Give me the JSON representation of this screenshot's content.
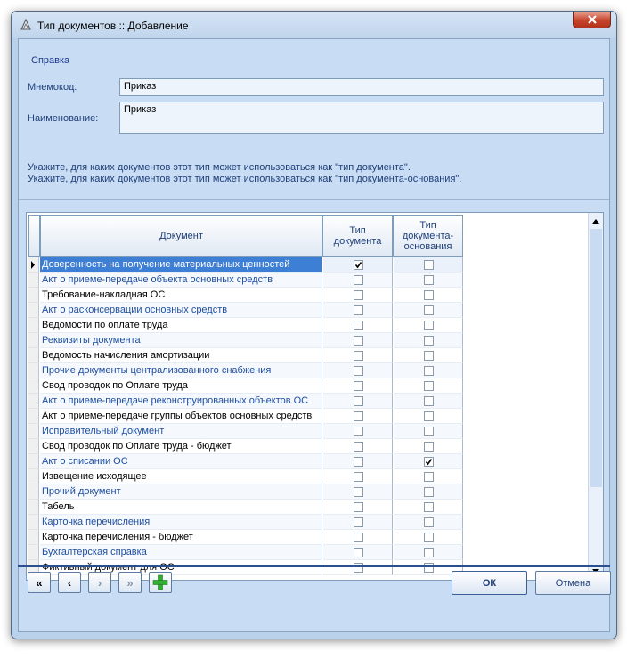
{
  "window": {
    "title": "Тип документов :: Добавление"
  },
  "menu": {
    "help": "Справка"
  },
  "form": {
    "mnemocode_label": "Мнемокод:",
    "mnemocode_value": "Приказ",
    "name_label": "Наименование:",
    "name_value": "Приказ"
  },
  "hints": [
    "Укажите, для каких документов этот тип может использоваться как \"тип документа\".",
    "Укажите, для каких документов этот тип может использоваться как \"тип документа-основания\"."
  ],
  "grid": {
    "columns": {
      "document": "Документ",
      "doc_type": "Тип документа",
      "base_type": "Тип документа-основания"
    },
    "rows": [
      {
        "document": "Доверенность на получение материальных ценностей",
        "doc_type": true,
        "base_type": false
      },
      {
        "document": "Акт о приеме-передаче объекта основных средств",
        "doc_type": false,
        "base_type": false
      },
      {
        "document": "Требование-накладная ОС",
        "doc_type": false,
        "base_type": false
      },
      {
        "document": "Акт о расконсервации основных средств",
        "doc_type": false,
        "base_type": false
      },
      {
        "document": "Ведомости по оплате труда",
        "doc_type": false,
        "base_type": false
      },
      {
        "document": "Реквизиты документа",
        "doc_type": false,
        "base_type": false
      },
      {
        "document": "Ведомость начисления амортизации",
        "doc_type": false,
        "base_type": false
      },
      {
        "document": "Прочие документы централизованного снабжения",
        "doc_type": false,
        "base_type": false
      },
      {
        "document": "Свод проводок по Оплате труда",
        "doc_type": false,
        "base_type": false
      },
      {
        "document": "Акт о приеме-передаче реконструированных объектов ОС",
        "doc_type": false,
        "base_type": false
      },
      {
        "document": "Акт о приеме-передаче группы объектов основных средств",
        "doc_type": false,
        "base_type": false
      },
      {
        "document": "Исправительный документ",
        "doc_type": false,
        "base_type": false
      },
      {
        "document": "Свод проводок по Оплате труда - бюджет",
        "doc_type": false,
        "base_type": false
      },
      {
        "document": "Акт о списании ОС",
        "doc_type": false,
        "base_type": true
      },
      {
        "document": "Извещение исходящее",
        "doc_type": false,
        "base_type": false
      },
      {
        "document": "Прочий документ",
        "doc_type": false,
        "base_type": false
      },
      {
        "document": "Табель",
        "doc_type": false,
        "base_type": false
      },
      {
        "document": "Карточка перечисления",
        "doc_type": false,
        "base_type": false
      },
      {
        "document": "Карточка перечисления - бюджет",
        "doc_type": false,
        "base_type": false
      },
      {
        "document": "Бухгалтерская справка",
        "doc_type": false,
        "base_type": false
      },
      {
        "document": "Фиктивный документ для ОС",
        "doc_type": false,
        "base_type": false
      }
    ]
  },
  "nav": {
    "first": "«",
    "prev": "‹",
    "next": "›",
    "last": "»",
    "add": "+"
  },
  "buttons": {
    "ok": "ОК",
    "cancel": "Отмена"
  },
  "colors": {
    "accent": "#3e7fd6",
    "add_icon": "#2fae2f",
    "close_button": "#c7432c"
  }
}
